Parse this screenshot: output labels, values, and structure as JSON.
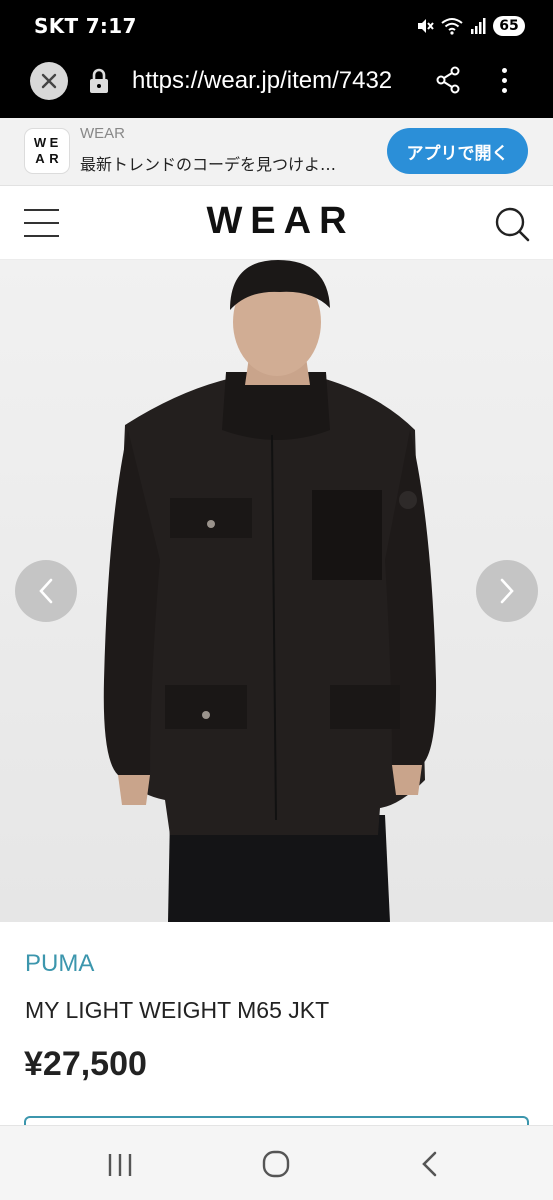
{
  "status_bar": {
    "carrier_time": "SKT 7:17",
    "battery": "65",
    "icons": [
      "mute-icon",
      "wifi-icon",
      "signal-icon",
      "battery-icon"
    ]
  },
  "browser": {
    "url": "https://wear.jp/item/7432",
    "icons": [
      "close-icon",
      "lock-icon",
      "share-icon",
      "more-icon"
    ]
  },
  "app_banner": {
    "logo_letters": [
      "W",
      "E",
      "A",
      "R"
    ],
    "app_name": "WEAR",
    "description": "最新トレンドのコーデを見つけよ…",
    "open_button": "アプリで開く",
    "accent": "#2b8fd8"
  },
  "header": {
    "logo": "WEAR",
    "icons": [
      "menu-icon",
      "search-icon"
    ]
  },
  "product": {
    "brand": "PUMA",
    "name": "MY LIGHT WEIGHT M65 JKT",
    "price": "¥27,500",
    "brand_color": "#3c96ad",
    "carousel_icons": [
      "chevron-left-icon",
      "chevron-right-icon"
    ]
  },
  "nav_bar": {
    "icons": [
      "recent-apps-icon",
      "home-icon",
      "back-icon"
    ]
  }
}
